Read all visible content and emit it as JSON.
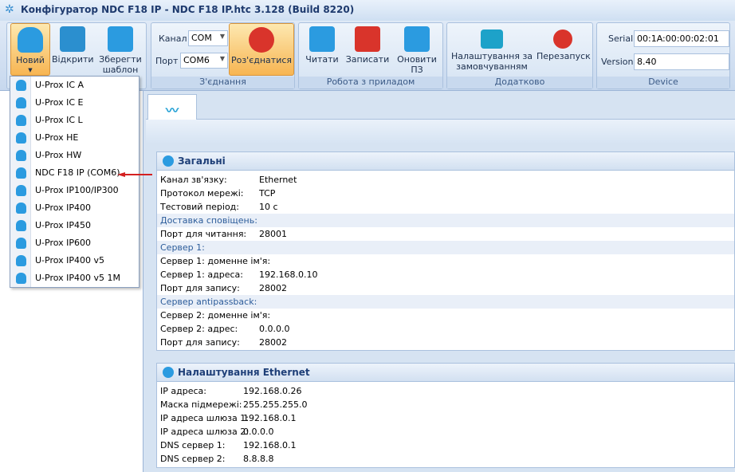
{
  "title": "Конфігуратор NDC F18 IP - NDC F18 IP.htc 3.128 (Build 8220)",
  "ribbon": {
    "new": "Новий",
    "open": "Відкрити",
    "save": "Зберегти шаблон",
    "channel_label": "Канал",
    "channel_value": "COM",
    "port_label": "Порт",
    "port_value": "COM6",
    "disconnect": "Роз'єднатися",
    "connection_group": "З'єднання",
    "read": "Читати",
    "write": "Записати",
    "update": "Оновити ПЗ",
    "device_work_group": "Робота з приладом",
    "defaults": "Налаштування за замовчуванням",
    "restart": "Перезапуск",
    "extra_group": "Додатково",
    "serial_label": "Serial",
    "serial_value": "00:1A:00:00:02:01",
    "version_label": "Version",
    "version_value": "8.40",
    "device_group": "Device"
  },
  "menu": [
    "U-Prox IC A",
    "U-Prox IC E",
    "U-Prox IC L",
    "U-Prox HE",
    "U-Prox HW",
    "NDC F18 IP (COM6)",
    "U-Prox IP100/IP300",
    "U-Prox IP400",
    "U-Prox IP450",
    "U-Prox IP600",
    "U-Prox IP400 v5",
    "U-Prox IP400 v5 1M"
  ],
  "general": {
    "title": "Загальні",
    "rows": [
      {
        "label": "Канал зв'язку:",
        "value": "Ethernet"
      },
      {
        "label": "Протокол мережі:",
        "value": "TCP"
      },
      {
        "label": "Тестовий період:",
        "value": "10 с"
      },
      {
        "label": "Доставка сповіщень:",
        "group": true
      },
      {
        "label": "Порт для читання:",
        "value": "28001"
      },
      {
        "label": "Сервер 1:",
        "group": true
      },
      {
        "label": "Сервер 1: доменне ім'я:",
        "value": ""
      },
      {
        "label": "Сервер 1: адреса:",
        "value": "192.168.0.10"
      },
      {
        "label": "Порт для запису:",
        "value": "28002"
      },
      {
        "label": "Сервер antipassback:",
        "group": true
      },
      {
        "label": "Сервер 2: доменне ім'я:",
        "value": ""
      },
      {
        "label": "Сервер 2: адрес:",
        "value": "0.0.0.0"
      },
      {
        "label": "Порт для запису:",
        "value": "28002"
      }
    ]
  },
  "ethernet": {
    "title": "Налаштування Ethernet",
    "rows": [
      {
        "label": "IP адреса:",
        "value": "192.168.0.26"
      },
      {
        "label": "Маска підмережі:",
        "value": "255.255.255.0"
      },
      {
        "label": "IP адреса шлюза 1:",
        "value": "192.168.0.1"
      },
      {
        "label": "IP адреса шлюза 2:",
        "value": "0.0.0.0"
      },
      {
        "label": "DNS сервер 1:",
        "value": "192.168.0.1"
      },
      {
        "label": "DNS сервер 2:",
        "value": "8.8.8.8"
      }
    ]
  }
}
